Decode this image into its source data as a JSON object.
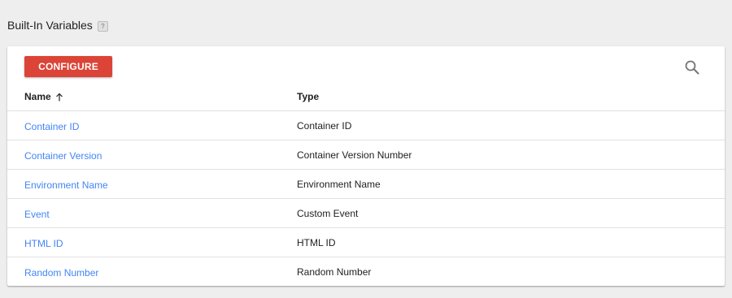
{
  "section": {
    "title": "Built-In Variables",
    "help_icon": "question-mark-icon",
    "help_text": "?"
  },
  "toolbar": {
    "configure_label": "CONFIGURE",
    "search_icon": "search-icon",
    "configure_color": "#db4437"
  },
  "table": {
    "columns": [
      {
        "label": "Name",
        "sort": "ascending",
        "sort_icon": "arrow-up-icon"
      },
      {
        "label": "Type"
      }
    ],
    "rows": [
      {
        "name": "Container ID",
        "type": "Container ID"
      },
      {
        "name": "Container Version",
        "type": "Container Version Number"
      },
      {
        "name": "Environment Name",
        "type": "Environment Name"
      },
      {
        "name": "Event",
        "type": "Custom Event"
      },
      {
        "name": "HTML ID",
        "type": "HTML ID"
      },
      {
        "name": "Random Number",
        "type": "Random Number"
      }
    ],
    "link_color": "#4285f4"
  }
}
